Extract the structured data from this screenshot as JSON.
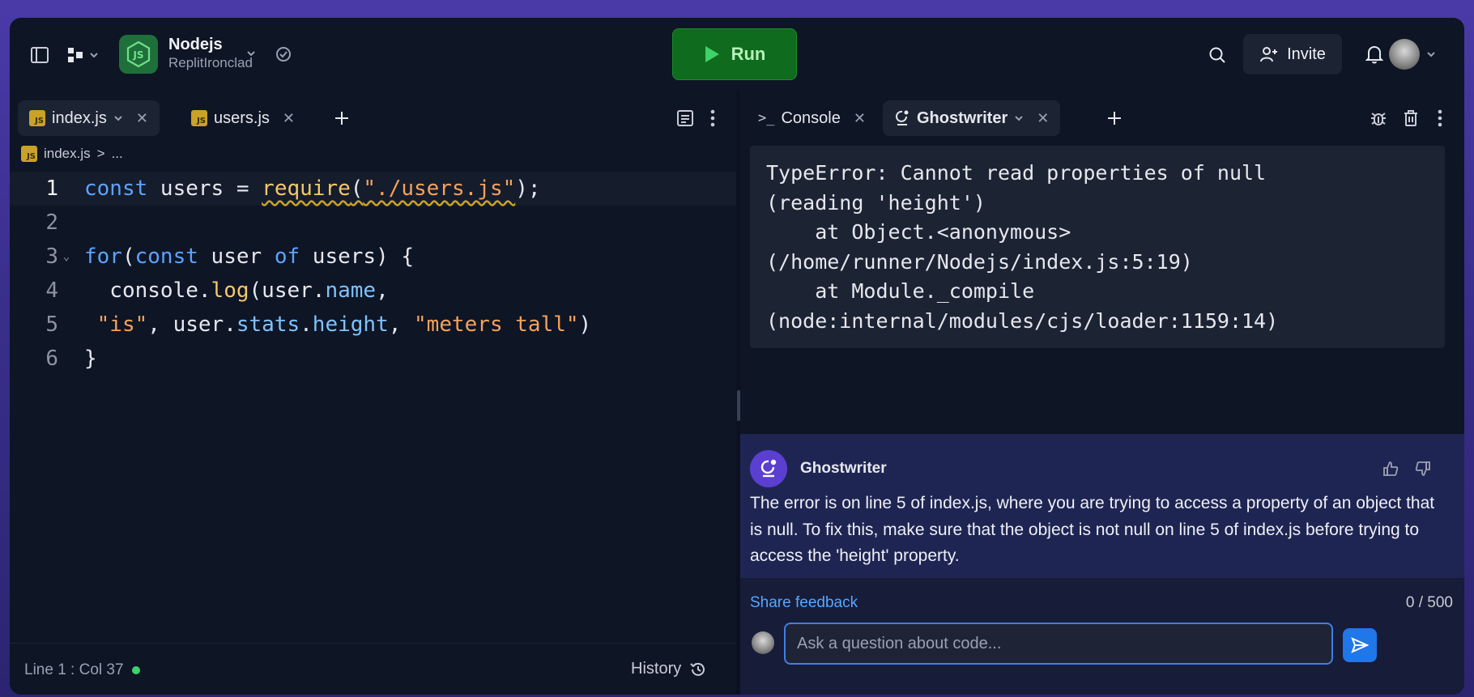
{
  "topbar": {
    "repl_name": "Nodejs",
    "repl_owner": "ReplitIronclad",
    "run_label": "Run",
    "invite_label": "Invite",
    "icons": {
      "sidebar": "sidebar-toggle-icon",
      "tools": "tools-icon",
      "repl_logo": "nodejs-icon",
      "status": "cloud-check-icon",
      "search": "search-icon",
      "invite": "add-user-icon",
      "notifications": "bell-icon"
    }
  },
  "editor": {
    "tabs": [
      {
        "label": "index.js",
        "active": true
      },
      {
        "label": "users.js",
        "active": false
      }
    ],
    "file_icon_text": "JS",
    "breadcrumb": {
      "file": "index.js",
      "sep": ">",
      "rest": "..."
    },
    "code": [
      {
        "n": "1",
        "current": true
      },
      {
        "n": "2"
      },
      {
        "n": "3",
        "fold": true
      },
      {
        "n": "4"
      },
      {
        "n": "5"
      },
      {
        "n": "6"
      }
    ],
    "tokens": {
      "l1_const": "const",
      "l1_users": " users = ",
      "l1_require": "require",
      "l1_open": "(",
      "l1_str": "\"./users.js\"",
      "l1_close": ");",
      "l3_for": "for",
      "l3_open": "(",
      "l3_const": "const",
      "l3_user": " user ",
      "l3_of": "of",
      "l3_rest": " users) {",
      "l4_console": "  console.",
      "l4_log": "log",
      "l4_open": "(user.",
      "l4_name": "name",
      "l4_comma": ",",
      "l5_is": " \"is\"",
      "l5_mid": ", user.",
      "l5_stats": "stats",
      "l5_dot": ".",
      "l5_height": "height",
      "l5_comma": ", ",
      "l5_tall": "\"meters tall\"",
      "l5_close": ")",
      "l6": "}"
    },
    "status": "Line 1 : Col 37",
    "history_label": "History"
  },
  "right": {
    "tabs": [
      {
        "label": "Console",
        "active": false
      },
      {
        "label": "Ghostwriter",
        "active": true
      }
    ],
    "console_prefix": ">_",
    "error_output": "TypeError: Cannot read properties of null\n(reading 'height')\n    at Object.<anonymous>\n(/home/runner/Nodejs/index.js:5:19)\n    at Module._compile\n(node:internal/modules/cjs/loader:1159:14)",
    "ghostwriter": {
      "name": "Ghostwriter",
      "message": "The error is on line 5 of index.js, where you are trying to access a property of an object that is null. To fix this, make sure that the object is not null on line 5 of index.js before trying to access the 'height' property.",
      "share_feedback": "Share feedback",
      "char_count": "0 / 500",
      "input_placeholder": "Ask a question about code..."
    }
  }
}
